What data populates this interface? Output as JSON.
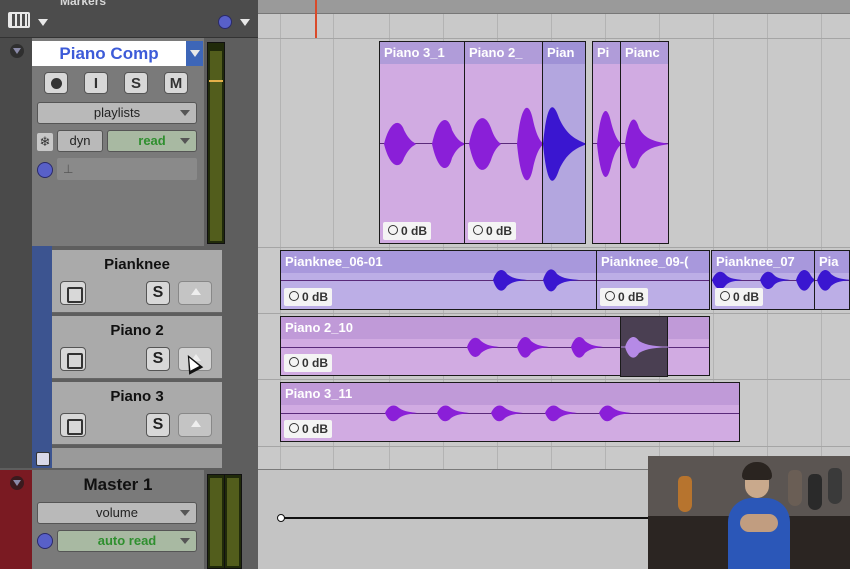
{
  "topbar": {
    "markers_label": "Markers"
  },
  "track_piano_comp": {
    "name": "Piano Comp",
    "buttons": {
      "record": "",
      "input": "I",
      "solo": "S",
      "mute": "M"
    },
    "playlists_label": "playlists",
    "dyn_label": "dyn",
    "automation_mode": "read"
  },
  "sub_tracks": [
    {
      "name": "Pianknee",
      "solo": "S"
    },
    {
      "name": "Piano 2",
      "solo": "S"
    },
    {
      "name": "Piano 3",
      "solo": "S"
    }
  ],
  "master": {
    "name": "Master 1",
    "view": "volume",
    "automation_mode": "auto read"
  },
  "clips": {
    "comp": [
      {
        "name": "Piano 3_1",
        "gain": "0 dB"
      },
      {
        "name": "Piano 2_",
        "gain": "0 dB"
      },
      {
        "name": "Pian",
        "gain": ""
      },
      {
        "name": "Pi",
        "gain": ""
      },
      {
        "name": "Pianc",
        "gain": ""
      }
    ],
    "pianknee": [
      {
        "name": "Pianknee_06-01",
        "gain": "0 dB"
      },
      {
        "name": "Pianknee_09-(",
        "gain": "0 dB"
      },
      {
        "name": "Pianknee_07",
        "gain": "0 dB"
      },
      {
        "name": "Pia",
        "gain": ""
      }
    ],
    "piano2": [
      {
        "name": "Piano 2_10",
        "gain": "0 dB"
      }
    ],
    "piano3": [
      {
        "name": "Piano 3_11",
        "gain": "0 dB"
      }
    ]
  },
  "colors": {
    "clip_purple": "#cdb0e6",
    "clip_header": "#b09cd9",
    "wave_purple": "#8a1fd8",
    "wave_blue": "#3a16d0",
    "name_blue": "#3d5bd8",
    "auto_green": "#2f8f2f"
  }
}
